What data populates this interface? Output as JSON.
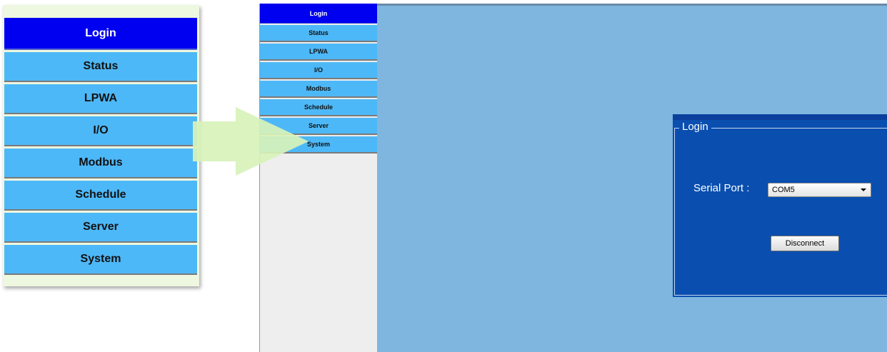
{
  "callout_menu": {
    "items": [
      {
        "label": "Login",
        "active": true
      },
      {
        "label": "Status"
      },
      {
        "label": "LPWA"
      },
      {
        "label": "I/O"
      },
      {
        "label": "Modbus"
      },
      {
        "label": "Schedule"
      },
      {
        "label": "Server"
      },
      {
        "label": "System"
      }
    ]
  },
  "app_menu": {
    "items": [
      {
        "label": "Login",
        "active": true
      },
      {
        "label": "Status"
      },
      {
        "label": "LPWA"
      },
      {
        "label": "I/O"
      },
      {
        "label": "Modbus"
      },
      {
        "label": "Schedule"
      },
      {
        "label": "Server"
      },
      {
        "label": "System"
      }
    ]
  },
  "login_panel": {
    "legend": "Login",
    "serial_port_label": "Serial Port :",
    "serial_port_value": "COM5",
    "disconnect_label": "Disconnect"
  },
  "colors": {
    "menu_active": "#0000f0",
    "menu_item": "#4db8f7",
    "content_bg": "#7fb6df",
    "panel_bg": "#0a4fb0",
    "callout_bg": "#eef7df",
    "arrow": "#d8f2b8"
  },
  "icons": {
    "arrow": "right-arrow-icon",
    "dropdown": "chevron-down-icon"
  }
}
